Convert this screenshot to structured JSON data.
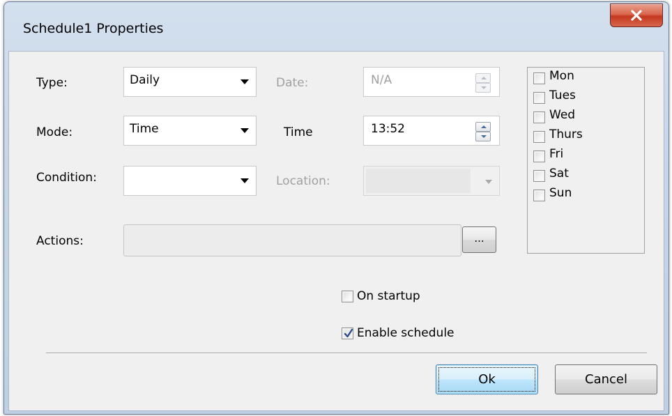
{
  "window": {
    "title": "Schedule1 Properties"
  },
  "form": {
    "type": {
      "label": "Type:",
      "value": "Daily"
    },
    "date": {
      "label": "Date:",
      "value": "N/A"
    },
    "mode": {
      "label": "Mode:",
      "value": "Time"
    },
    "time": {
      "label": "Time",
      "value": "13:52"
    },
    "condition": {
      "label": "Condition:",
      "value": ""
    },
    "location": {
      "label": "Location:",
      "value": ""
    },
    "actions": {
      "label": "Actions:",
      "value": "",
      "browse_label": "..."
    }
  },
  "days": [
    {
      "label": "Mon",
      "checked": false
    },
    {
      "label": "Tues",
      "checked": false
    },
    {
      "label": "Wed",
      "checked": false
    },
    {
      "label": "Thurs",
      "checked": false
    },
    {
      "label": "Fri",
      "checked": false
    },
    {
      "label": "Sat",
      "checked": false
    },
    {
      "label": "Sun",
      "checked": false
    }
  ],
  "options": {
    "on_startup": {
      "label": "On startup",
      "checked": false
    },
    "enable_schedule": {
      "label": "Enable schedule",
      "checked": true
    }
  },
  "buttons": {
    "ok_label": "Ok",
    "cancel_label": "Cancel"
  },
  "colors": {
    "window_frame": "#c6d6e8",
    "client_bg": "#f0f0f0",
    "close_button": "#c2391f",
    "checkmark": "#2b4d8b",
    "default_button_border": "#3c7fb1"
  },
  "icons": {
    "close": "close-x-icon",
    "dropdown": "chevron-down-icon",
    "spin_up": "spin-up-icon",
    "spin_down": "spin-down-icon",
    "check": "checkmark-icon"
  }
}
